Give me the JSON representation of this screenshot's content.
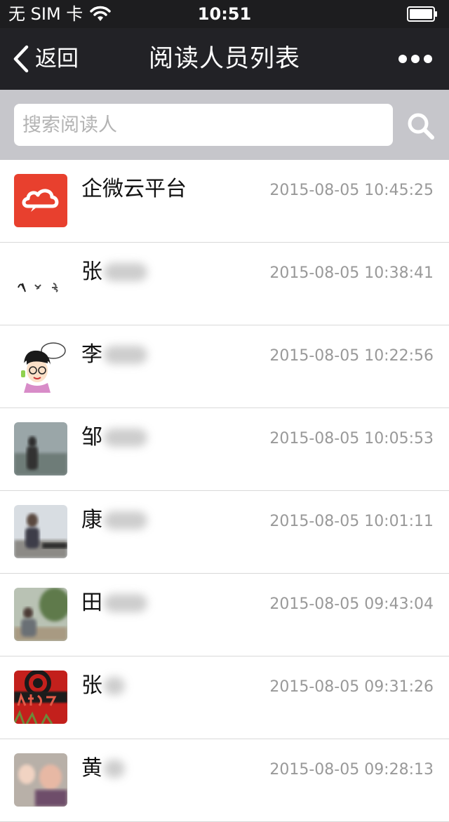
{
  "status_bar": {
    "carrier": "无 SIM 卡",
    "time": "10:51"
  },
  "nav": {
    "back_label": "返回",
    "title": "阅读人员列表"
  },
  "search": {
    "placeholder": "搜索阅读人",
    "value": ""
  },
  "readers": [
    {
      "name": "企微云平台",
      "time": "2015-08-05 10:45:25",
      "avatar": "cloud-logo-avatar"
    },
    {
      "name": "张",
      "time": "2015-08-05 10:38:41",
      "avatar": "calligraphy-avatar"
    },
    {
      "name": "李",
      "time": "2015-08-05 10:22:56",
      "avatar": "cartoon-girl-avatar"
    },
    {
      "name": "邹",
      "time": "2015-08-05 10:05:53",
      "avatar": "photo-avatar"
    },
    {
      "name": "康",
      "time": "2015-08-05 10:01:11",
      "avatar": "photo-avatar"
    },
    {
      "name": "田",
      "time": "2015-08-05 09:43:04",
      "avatar": "photo-avatar"
    },
    {
      "name": "张",
      "time": "2015-08-05 09:31:26",
      "avatar": "red-logo-avatar"
    },
    {
      "name": "黄",
      "time": "2015-08-05 09:28:13",
      "avatar": "photo-avatar"
    }
  ],
  "colors": {
    "nav_background": "#222226",
    "search_background": "#c6c6cb",
    "brand_red": "#e8402e",
    "time_text": "#999999"
  }
}
